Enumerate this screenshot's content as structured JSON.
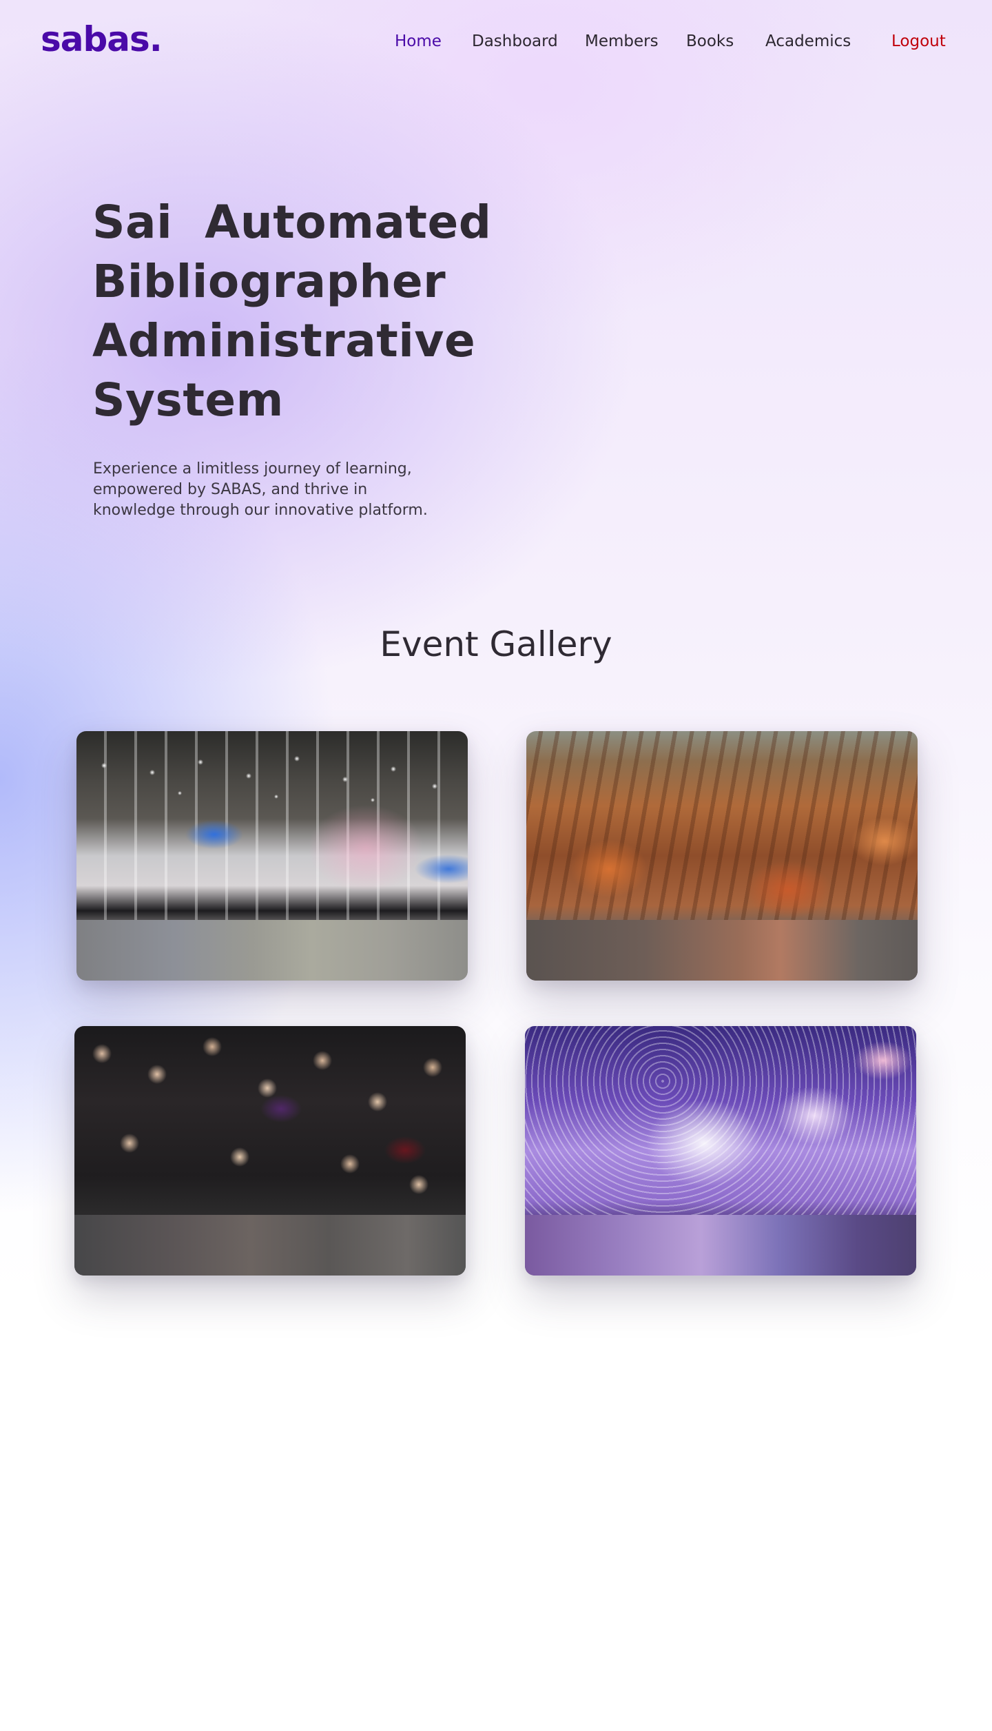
{
  "brand": {
    "logo": "sabas.",
    "color": "#4a0aa8"
  },
  "nav": {
    "items": [
      {
        "label": "Home",
        "active": true
      },
      {
        "label": "Dashboard",
        "active": false
      },
      {
        "label": "Members",
        "active": false
      },
      {
        "label": "Books",
        "active": false
      },
      {
        "label": "Academics",
        "active": false
      }
    ],
    "logout_label": "Logout",
    "logout_color": "#c0000a"
  },
  "hero": {
    "title_lines": [
      "Sai  Automated",
      "Bibliographer",
      "Administrative",
      "System"
    ],
    "subtitle": "Experience a limitless journey of learning, empowered by SABAS, and thrive in knowledge through our innovative platform."
  },
  "gallery": {
    "title": "Event Gallery",
    "cards": [
      {
        "image": "conference-hall-photo"
      },
      {
        "image": "festival-crowd-photo"
      },
      {
        "image": "formal-audience-photo"
      },
      {
        "image": "confetti-concert-photo"
      }
    ]
  }
}
